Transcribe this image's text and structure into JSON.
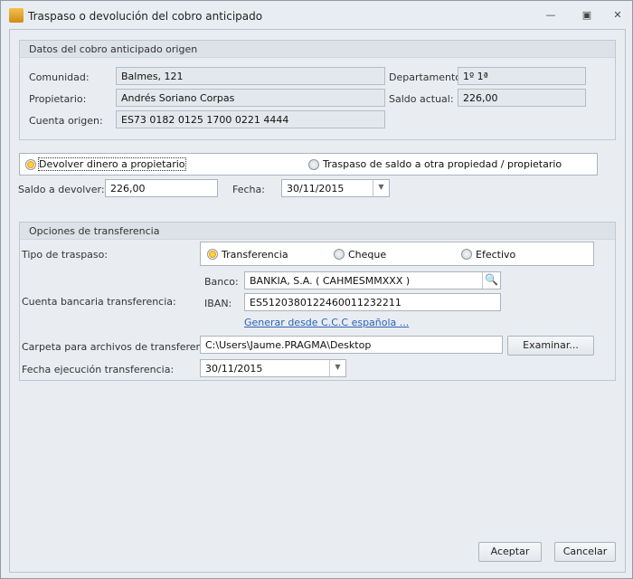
{
  "window": {
    "title": "Traspaso o devolución del cobro anticipado"
  },
  "origen": {
    "header": "Datos del cobro anticipado origen",
    "comunidad_label": "Comunidad:",
    "comunidad": "Balmes, 121",
    "propietario_label": "Propietario:",
    "propietario": "Andrés Soriano Corpas",
    "cuenta_label": "Cuenta origen:",
    "cuenta": "ES73 0182 0125 1700 0221 4444",
    "departamento_label": "Departamento:",
    "departamento": "1º 1ª",
    "saldo_label": "Saldo actual:",
    "saldo": "226,00"
  },
  "modo": {
    "devolver": "Devolver dinero a propietario",
    "traspaso": "Traspaso de saldo a otra propiedad / propietario",
    "selected": "devolver"
  },
  "saldo_devolver_label": "Saldo a devolver:",
  "saldo_devolver": "226,00",
  "fecha_label": "Fecha:",
  "fecha": "30/11/2015",
  "transfer": {
    "header": "Opciones de transferencia",
    "tipo_label": "Tipo de traspaso:",
    "tipo_options": [
      "Transferencia",
      "Cheque",
      "Efectivo"
    ],
    "tipo_selected": "Transferencia",
    "cuenta_label": "Cuenta bancaria transferencia:",
    "banco_label": "Banco:",
    "banco": "BANKIA, S.A. ( CAHMESMMXXX )",
    "iban_label": "IBAN:",
    "iban": "ES5120380122460011232211",
    "generar_link": "Generar desde C.C.C española ...",
    "carpeta_label": "Carpeta para archivos de transferencia:",
    "carpeta": "C:\\Users\\Jaume.PRAGMA\\Desktop",
    "examinar": "Examinar...",
    "fecha_ejec_label": "Fecha ejecución transferencia:",
    "fecha_ejec": "30/11/2015"
  },
  "buttons": {
    "aceptar": "Aceptar",
    "cancelar": "Cancelar"
  }
}
